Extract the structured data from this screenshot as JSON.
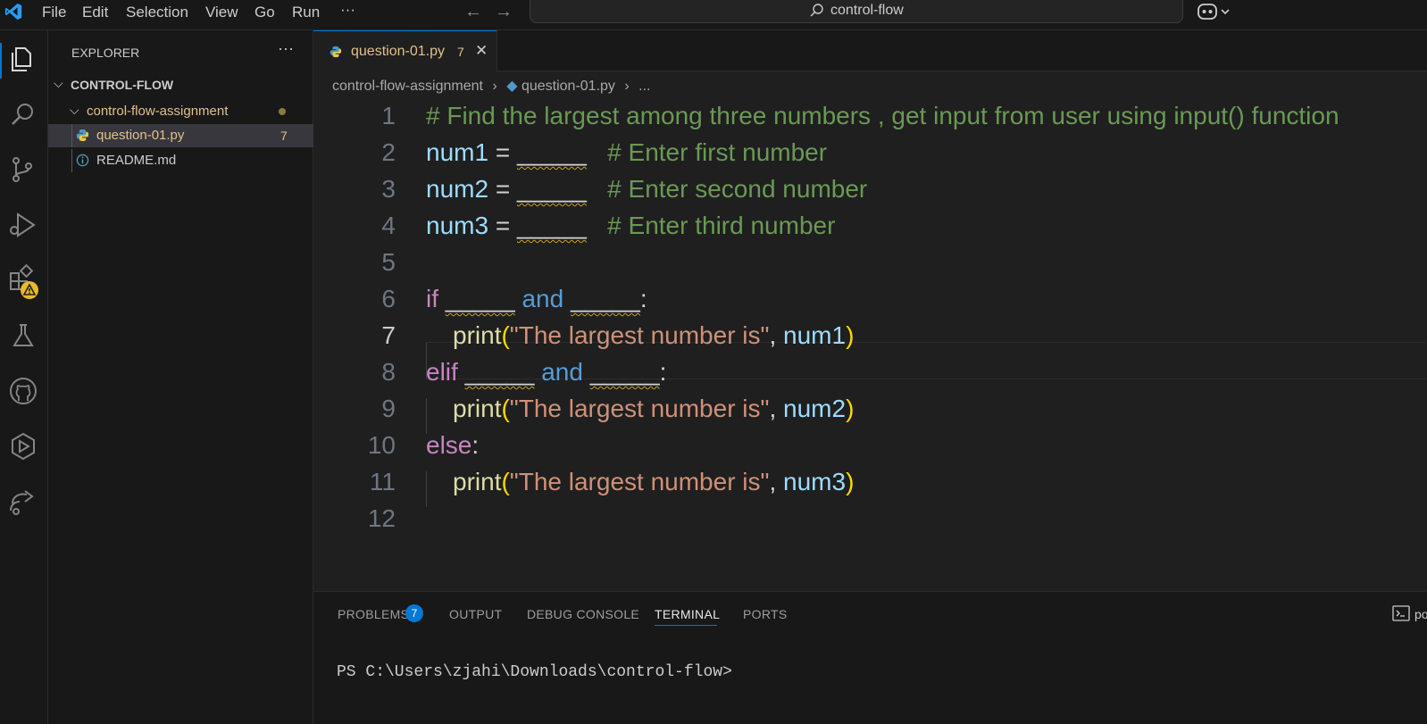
{
  "colors": {
    "accent": "#0078d4",
    "modified": "#e2c08d",
    "comment": "#6a9955",
    "keyword": "#c586c0",
    "string": "#ce9178",
    "variable": "#9cdcfe",
    "function": "#dcdcaa"
  },
  "titlebar": {
    "menus": [
      "File",
      "Edit",
      "Selection",
      "View",
      "Go",
      "Run",
      "···"
    ],
    "search": "control-flow"
  },
  "activity_icons": [
    "explorer-icon",
    "search-icon",
    "source-control-icon",
    "run-debug-icon",
    "extensions-icon",
    "testing-icon",
    "github-icon",
    "remote-explorer-icon",
    "live-share-icon"
  ],
  "sidebar": {
    "title": "EXPLORER",
    "more": "···",
    "root": "CONTROL-FLOW",
    "folder": "control-flow-assignment",
    "files": [
      {
        "name": "question-01.py",
        "badge": "7",
        "icon": "python-icon"
      },
      {
        "name": "README.md",
        "badge": "",
        "icon": "info-icon"
      }
    ]
  },
  "editor": {
    "tab": {
      "name": "question-01.py",
      "problems": "7",
      "close": "✕"
    },
    "breadcrumb": [
      "control-flow-assignment",
      "question-01.py",
      "..."
    ],
    "line_numbers": [
      "1",
      "2",
      "3",
      "4",
      "5",
      "6",
      "7",
      "8",
      "9",
      "10",
      "11",
      "12"
    ],
    "code": {
      "l1": "# Find the largest among three numbers , get input from user using input() function",
      "l2": {
        "var": "num1",
        "eq": " = ",
        "blank": "_____",
        "cm": "   # Enter first number"
      },
      "l3": {
        "var": "num2",
        "eq": " = ",
        "blank": "_____",
        "cm": "   # Enter second number"
      },
      "l4": {
        "var": "num3",
        "eq": " = ",
        "blank": "_____",
        "cm": "   # Enter third number"
      },
      "l6": {
        "kw": "if",
        "b1": "_____",
        "and": "and",
        "b2": "_____",
        "colon": ":"
      },
      "l7": {
        "fn": "print",
        "po": "(",
        "st": "\"The largest number is\"",
        "comma": ", ",
        "var": "num1",
        "pc": ")"
      },
      "l8": {
        "kw": "elif",
        "b1": "_____",
        "and": "and",
        "b2": "_____",
        "colon": ":"
      },
      "l9": {
        "fn": "print",
        "po": "(",
        "st": "\"The largest number is\"",
        "comma": ", ",
        "var": "num2",
        "pc": ")"
      },
      "l10": {
        "kw": "else",
        "colon": ":"
      },
      "l11": {
        "fn": "print",
        "po": "(",
        "st": "\"The largest number is\"",
        "comma": ", ",
        "var": "num3",
        "pc": ")"
      }
    }
  },
  "panel": {
    "tabs": [
      "PROBLEMS",
      "OUTPUT",
      "DEBUG CONSOLE",
      "TERMINAL",
      "PORTS"
    ],
    "active": "TERMINAL",
    "problems_count": "7",
    "terminal_prompt": "PS C:\\Users\\zjahi\\Downloads\\control-flow>",
    "side_label": "po"
  }
}
